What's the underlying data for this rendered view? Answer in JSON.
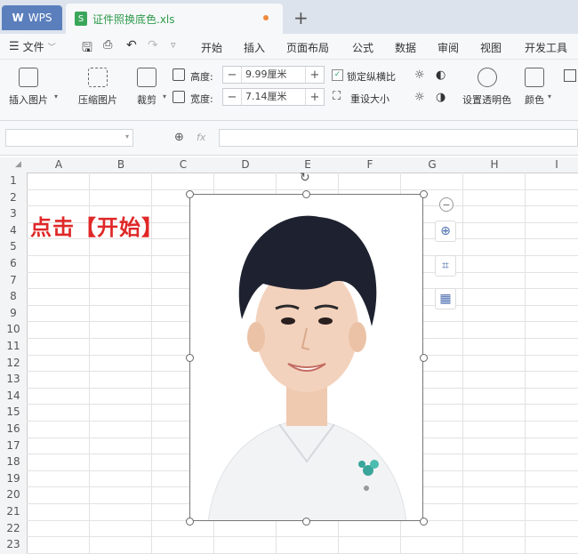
{
  "tabs": {
    "wps_label": "WPS",
    "file_name": "证件照换底色.xls",
    "new_tab": "+"
  },
  "menu": {
    "file_label": "文件",
    "items": [
      "开始",
      "插入",
      "页面布局",
      "公式",
      "数据",
      "审阅",
      "视图",
      "开发工具"
    ]
  },
  "ribbon": {
    "insert_picture": "插入图片",
    "compress_picture": "压缩图片",
    "crop": "裁剪",
    "height_label": "高度:",
    "height_value": "9.99厘米",
    "width_label": "宽度:",
    "width_value": "7.14厘米",
    "lock_ratio": "锁定纵横比",
    "reset_size": "重设大小",
    "set_transparent": "设置透明色",
    "color": "颜色"
  },
  "formula_bar": {
    "fx": "fx"
  },
  "columns": [
    "A",
    "B",
    "C",
    "D",
    "E",
    "F",
    "G",
    "H",
    "I"
  ],
  "rows": [
    "1",
    "2",
    "3",
    "4",
    "5",
    "6",
    "7",
    "8",
    "9",
    "10",
    "11",
    "12",
    "13",
    "14",
    "15",
    "16",
    "17",
    "18",
    "19",
    "20",
    "21",
    "22",
    "23"
  ],
  "annotation": "点击【开始】"
}
